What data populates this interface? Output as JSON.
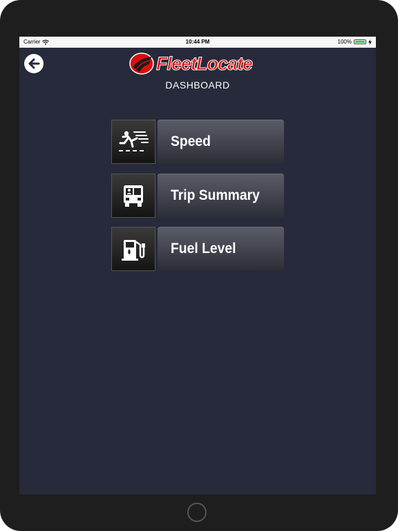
{
  "status_bar": {
    "carrier": "Carrier",
    "time": "10:44 PM",
    "battery_label": "100%",
    "battery_level": 1.0,
    "icons": [
      "wifi-icon",
      "battery-icon",
      "charging-icon"
    ]
  },
  "header": {
    "logo_text": "FleetLocate",
    "title": "DASHBOARD",
    "back_icon": "back-arrow-icon"
  },
  "menu": {
    "items": [
      {
        "label": "Speed",
        "icon": "speed-icon"
      },
      {
        "label": "Trip Summary",
        "icon": "bus-icon"
      },
      {
        "label": "Fuel Level",
        "icon": "fuel-pump-icon"
      }
    ]
  },
  "colors": {
    "background": "#262a3a",
    "device_frame": "#1e1e1e",
    "logo_red": "#e01010",
    "status_bar": "#f7f7f7"
  }
}
